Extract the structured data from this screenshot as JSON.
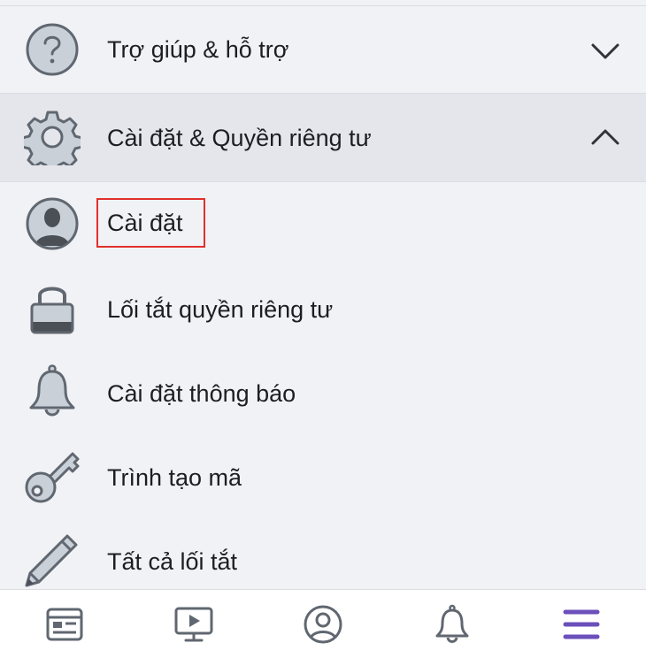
{
  "menu": {
    "help_section": {
      "label": "Trợ giúp & hỗ trợ",
      "expanded": false
    },
    "settings_section": {
      "label": "Cài đặt & Quyền riêng tư",
      "expanded": true
    },
    "items": [
      {
        "label": "Cài đặt",
        "icon": "profile-icon",
        "highlighted": true
      },
      {
        "label": "Lối tắt quyền riêng tư",
        "icon": "lock-icon"
      },
      {
        "label": "Cài đặt thông báo",
        "icon": "bell-icon"
      },
      {
        "label": "Trình tạo mã",
        "icon": "key-icon"
      },
      {
        "label": "Tất cả lối tắt",
        "icon": "pencil-icon"
      }
    ]
  },
  "tabbar": {
    "tabs": [
      {
        "icon": "news-feed-icon",
        "active": false
      },
      {
        "icon": "video-icon",
        "active": false
      },
      {
        "icon": "profile-icon",
        "active": false
      },
      {
        "icon": "notifications-icon",
        "active": false
      },
      {
        "icon": "menu-icon",
        "active": true
      }
    ]
  },
  "colors": {
    "background": "#f0f2f5",
    "expanded_row": "#e4e6eb",
    "text": "#1c1e21",
    "icon_gray": "#606770",
    "icon_fill": "#c9d0d8",
    "highlight_border": "#e0302c",
    "active_tab": "#6b4fbb"
  }
}
